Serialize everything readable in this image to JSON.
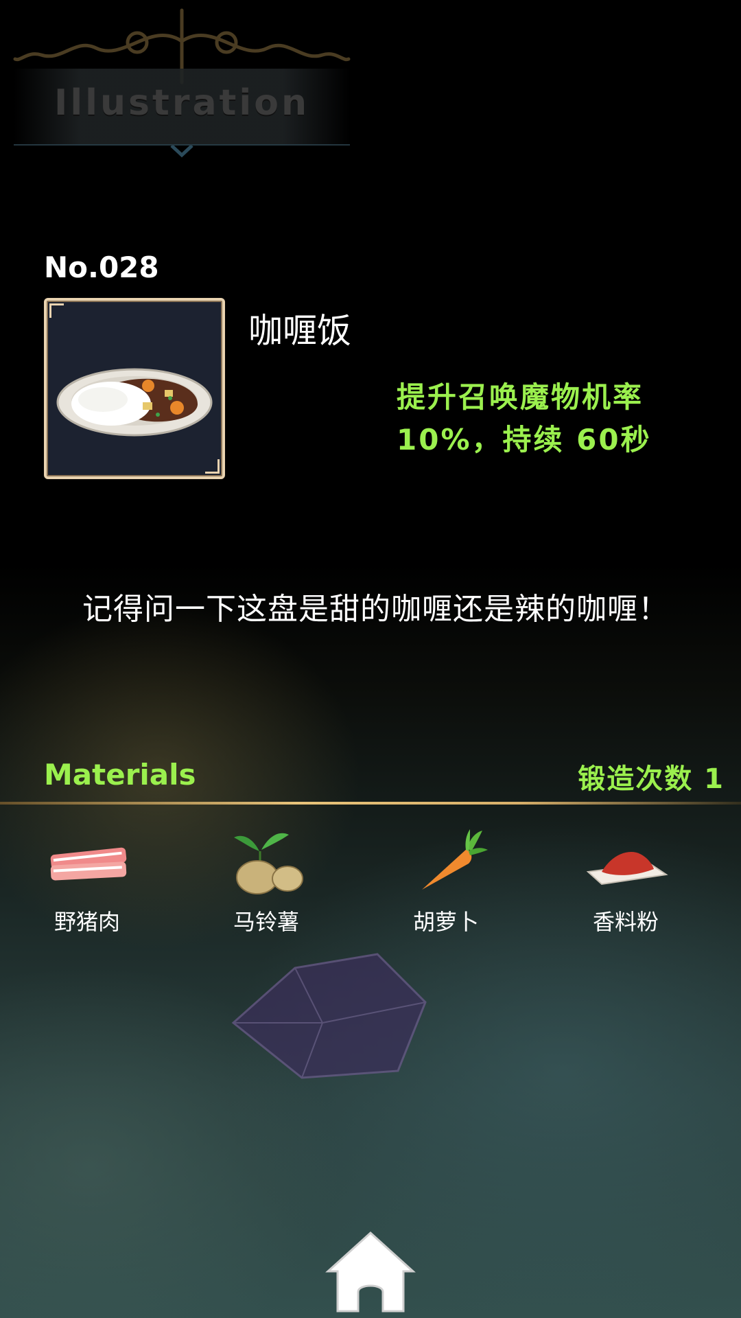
{
  "header": {
    "title": "Illustration"
  },
  "item": {
    "number": "No.028",
    "name": "咖喱饭",
    "effect": "提升召唤魔物机率 10%，持续 60秒",
    "description": "记得问一下这盘是甜的咖喱还是辣的咖喱！",
    "image_icon": "curry-rice-icon"
  },
  "materials": {
    "title": "Materials",
    "forge_count": "锻造次数 1",
    "items": [
      {
        "label": "野猪肉",
        "icon": "boar-meat-icon"
      },
      {
        "label": "马铃薯",
        "icon": "potato-icon"
      },
      {
        "label": "胡萝卜",
        "icon": "carrot-icon"
      },
      {
        "label": "香料粉",
        "icon": "spice-powder-icon"
      }
    ]
  },
  "nav": {
    "home_icon": "home-icon"
  },
  "colors": {
    "accent_green": "#9bf04e",
    "frame_gold": "#e9d3b0",
    "divider_gold": "#e8c37a"
  }
}
